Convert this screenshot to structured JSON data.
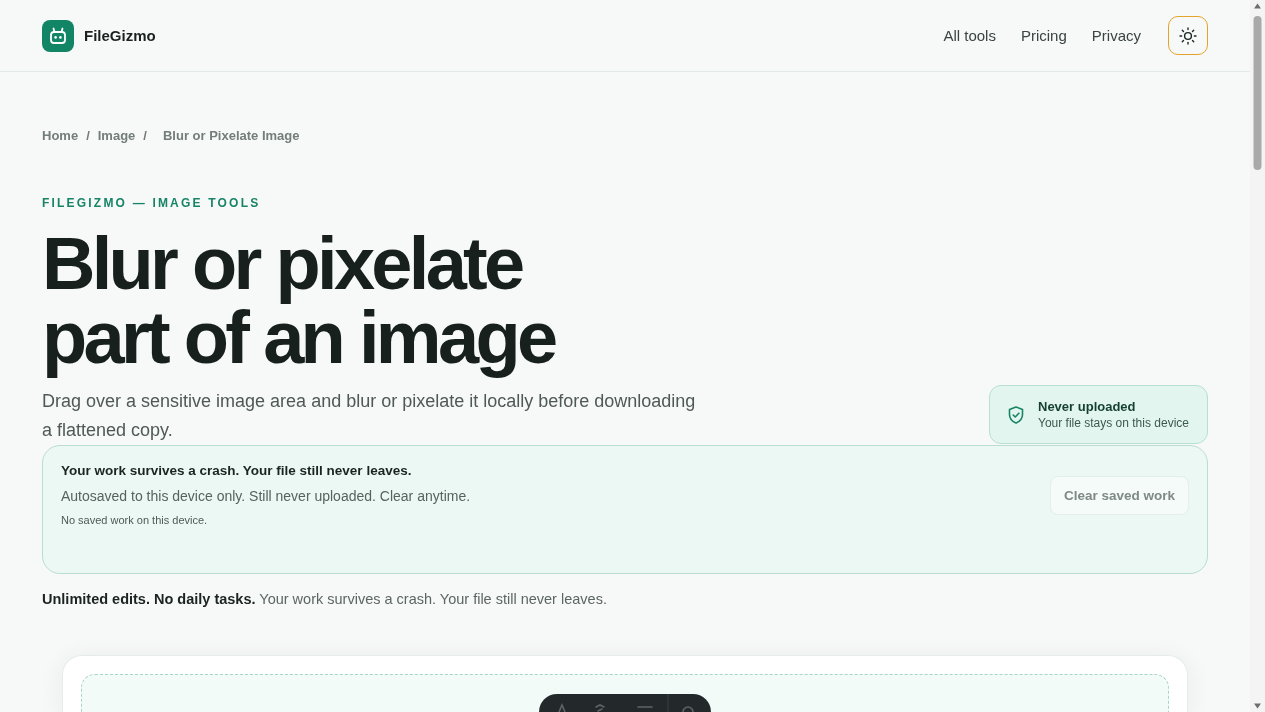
{
  "header": {
    "brand": "FileGizmo",
    "nav": [
      {
        "label": "All tools"
      },
      {
        "label": "Pricing"
      },
      {
        "label": "Privacy"
      }
    ]
  },
  "breadcrumb": [
    {
      "label": "Home",
      "separator": "/"
    },
    {
      "label": "Image",
      "separator": "/"
    },
    {
      "label": "Blur or Pixelate Image"
    }
  ],
  "hero": {
    "eyebrow": "FILEGIZMO — IMAGE TOOLS",
    "title": "Blur or pixelate part of an image",
    "subtitle": "Drag over a sensitive image area and blur or pixelate it locally before downloading a flattened copy."
  },
  "trust_badge": {
    "title": "Never uploaded",
    "subtitle": "Your file stays on this device"
  },
  "autosave_notice": {
    "title": "Your work survives a crash. Your file still never leaves.",
    "description": "Autosaved to this device only. Still never uploaded. Clear anytime.",
    "status": "No saved work on this device.",
    "clear_button": {
      "label": "Clear saved work",
      "disabled": true
    }
  },
  "tagline": "**Unlimited edits. No daily tasks.** Your work survives a crash. Your file still never leaves."
}
